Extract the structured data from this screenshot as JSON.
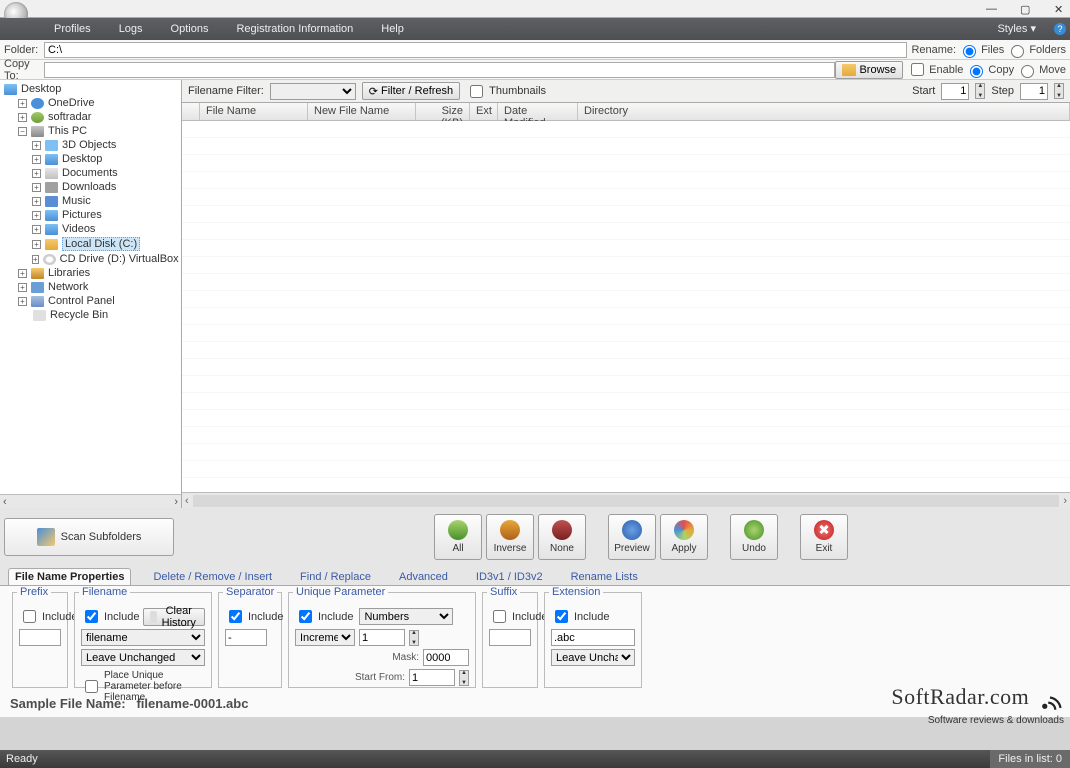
{
  "window": {
    "minimize": "—",
    "maximize": "▢",
    "close": "✕"
  },
  "menu": {
    "profiles": "Profiles",
    "logs": "Logs",
    "options": "Options",
    "reg": "Registration Information",
    "help": "Help",
    "styles": "Styles ▾"
  },
  "paths": {
    "folder_lab": "Folder:",
    "folder_val": "C:\\",
    "copy_lab": "Copy To:",
    "copy_val": ""
  },
  "rename": {
    "label": "Rename:",
    "files": "Files",
    "folders": "Folders"
  },
  "copyopt": {
    "enable": "Enable",
    "copy": "Copy",
    "move": "Move"
  },
  "browse": "Browse",
  "tree": {
    "root": "Desktop",
    "onedrive": "OneDrive",
    "softradar": "softradar",
    "thispc": "This PC",
    "threed": "3D Objects",
    "desktop2": "Desktop",
    "docs": "Documents",
    "dl": "Downloads",
    "music": "Music",
    "pics": "Pictures",
    "vids": "Videos",
    "cdrive": "Local Disk (C:)",
    "dvd": "CD Drive (D:) VirtualBox Gue",
    "libs": "Libraries",
    "net": "Network",
    "ctrl": "Control Panel",
    "bin": "Recycle Bin"
  },
  "filter": {
    "lab": "Filename Filter:",
    "val": "",
    "btn": "Filter / Refresh",
    "thumbs": "Thumbnails",
    "start": "Start",
    "start_val": "1",
    "step": "Step",
    "step_val": "1"
  },
  "cols": {
    "name": "File Name",
    "new": "New File Name",
    "size": "Size (KB)",
    "ext": "Ext",
    "date": "Date Modified",
    "dir": "Directory"
  },
  "scan": "Scan Subfolders",
  "act": {
    "all": "All",
    "inv": "Inverse",
    "none": "None",
    "prev": "Preview",
    "apply": "Apply",
    "undo": "Undo",
    "exit": "Exit"
  },
  "tabs": {
    "fnp": "File Name Properties",
    "dri": "Delete / Remove / Insert",
    "fr": "Find / Replace",
    "adv": "Advanced",
    "id3": "ID3v1 / ID3v2",
    "rl": "Rename Lists"
  },
  "grp": {
    "prefix": {
      "legend": "Prefix",
      "include": "Include"
    },
    "filename": {
      "legend": "Filename",
      "include": "Include",
      "clear": "Clear History",
      "val": "filename",
      "mode": "Leave Unchanged",
      "place": "Place Unique Parameter before Filename"
    },
    "sep": {
      "legend": "Separator",
      "include": "Include",
      "val": "-"
    },
    "unique": {
      "legend": "Unique Parameter",
      "include": "Include",
      "type": "Numbers",
      "mode": "Increment",
      "mode_val": "1",
      "mask_lab": "Mask:",
      "mask": "0000",
      "start_lab": "Start From:",
      "start": "1"
    },
    "suffix": {
      "legend": "Suffix",
      "include": "Include"
    },
    "ext": {
      "legend": "Extension",
      "include": "Include",
      "val": ".abc",
      "mode": "Leave Unchanged"
    }
  },
  "sample": {
    "lab": "Sample File Name:",
    "val": "filename-0001.abc"
  },
  "watermark": {
    "big": "SoftRadar.com",
    "small": "Software reviews & downloads"
  },
  "status": {
    "left": "Ready",
    "right": "Files in list: 0"
  }
}
